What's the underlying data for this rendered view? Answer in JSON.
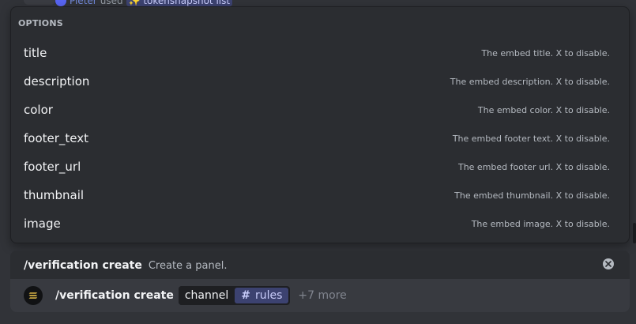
{
  "background_line": {
    "user": "Pieter",
    "verb": "used",
    "command": "✨ tokensnapshot list"
  },
  "options_panel": {
    "header": "OPTIONS",
    "items": [
      {
        "name": "title",
        "description": "The embed title. X to disable."
      },
      {
        "name": "description",
        "description": "The embed description. X to disable."
      },
      {
        "name": "color",
        "description": "The embed color. X to disable."
      },
      {
        "name": "footer_text",
        "description": "The embed footer text. X to disable."
      },
      {
        "name": "footer_url",
        "description": "The embed footer url. X to disable."
      },
      {
        "name": "thumbnail",
        "description": "The embed thumbnail. X to disable."
      },
      {
        "name": "image",
        "description": "The embed image. X to disable."
      }
    ]
  },
  "command_preview": {
    "name": "/verification create",
    "description": "Create a panel.",
    "close_icon": "close-circle-icon"
  },
  "command_input": {
    "app_icon": "solana-logo-icon",
    "name": "/verification create",
    "param_name": "channel",
    "param_value_prefix": "#",
    "param_value": "rules",
    "more": "+7 more"
  },
  "colors": {
    "background": "#313338",
    "panel": "#2b2d31",
    "input": "#383a40",
    "mention_bg": "#3c4270",
    "mention_text": "#c9cdfb",
    "muted": "#b5bac1"
  }
}
